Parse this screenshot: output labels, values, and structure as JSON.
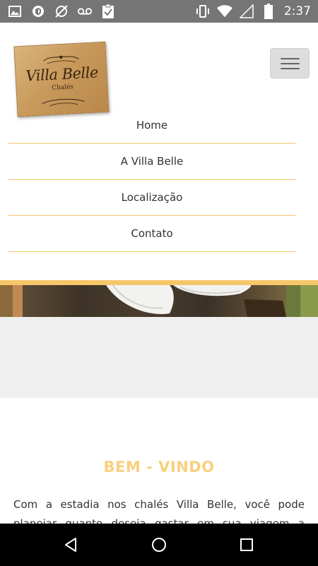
{
  "status_bar": {
    "time": "2:37",
    "left_icons": [
      "image-icon",
      "shield-icon",
      "sync-off-icon",
      "voicemail-icon",
      "clipboard-check-icon"
    ],
    "right_icons": [
      "vibrate-icon",
      "wifi-icon",
      "signal-icon",
      "battery-icon"
    ]
  },
  "header": {
    "logo_text": "Villa Belle",
    "logo_subtext": "Chalés"
  },
  "nav": {
    "items": [
      {
        "label": "Home"
      },
      {
        "label": "A Villa Belle"
      },
      {
        "label": "Localização"
      },
      {
        "label": "Contato"
      }
    ]
  },
  "content": {
    "heading": "BEM - VINDO",
    "intro": "Com a estadia nos chalés Villa Belle, você pode planejar quanto deseja gastar em sua viagem a Campos do Jordão"
  },
  "colors": {
    "accent": "#f9cf7e",
    "divider": "#f3c969",
    "status_bar": "#757575"
  }
}
